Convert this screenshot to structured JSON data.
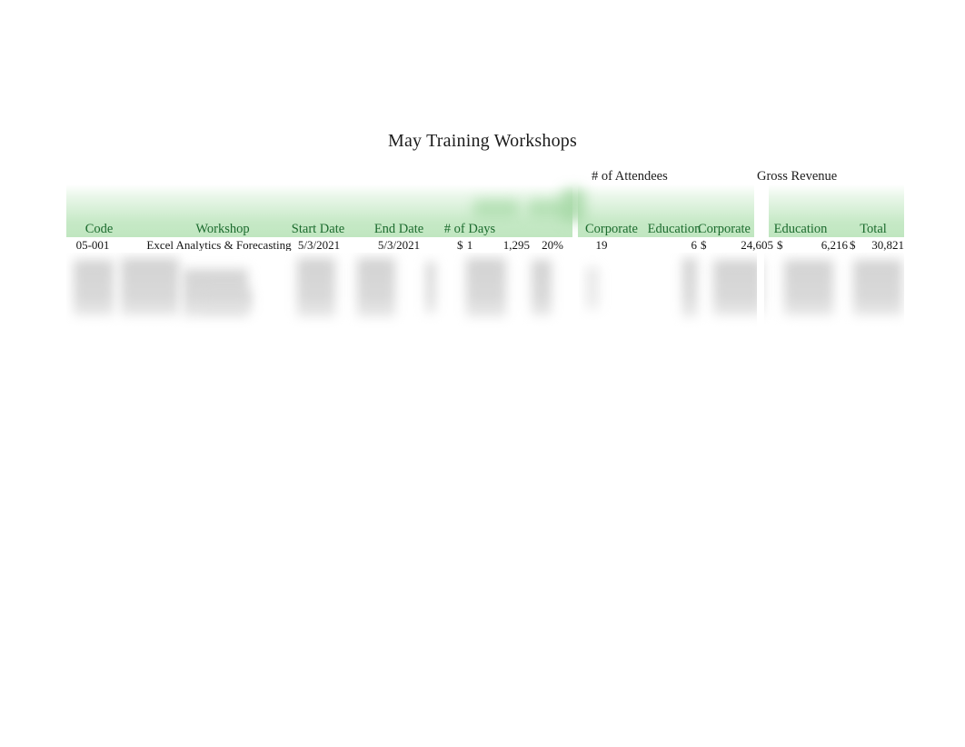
{
  "report": {
    "title": "May Training Workshops"
  },
  "theme": {
    "header_band_green": "#c6e9c6",
    "header_text_green": "#1c6b2e",
    "body_text": "#141414",
    "page_background": "#ffffff"
  },
  "table": {
    "group_headers": [
      {
        "label": "# of Attendees",
        "spans": [
          "Corporate",
          "Education"
        ]
      },
      {
        "label": "Gross Revenue",
        "spans": [
          "Corporate",
          "Education",
          "Total"
        ]
      }
    ],
    "columns": [
      {
        "key": "code",
        "label": "Code",
        "align": "center"
      },
      {
        "key": "workshop",
        "label": "Workshop",
        "align": "center"
      },
      {
        "key": "start_date",
        "label": "Start Date",
        "align": "center"
      },
      {
        "key": "end_date",
        "label": "End Date",
        "align": "center"
      },
      {
        "key": "days",
        "label": "# of Days",
        "align": "center"
      },
      {
        "key": "price",
        "label": "",
        "align": "center"
      },
      {
        "key": "discount",
        "label": "",
        "align": "center"
      },
      {
        "key": "att_corporate",
        "label": "Corporate",
        "align": "center"
      },
      {
        "key": "att_education",
        "label": "Education",
        "align": "center"
      },
      {
        "key": "rev_corporate",
        "label": "Corporate",
        "align": "center"
      },
      {
        "key": "rev_education",
        "label": "Education",
        "align": "center"
      },
      {
        "key": "rev_total",
        "label": "Total",
        "align": "center"
      }
    ],
    "rows": [
      {
        "code": "05-001",
        "workshop": "Excel Analytics & Forecasting",
        "start_date": "5/3/2021",
        "end_date": "5/3/2021",
        "days": "1",
        "price_symbol": "$",
        "price": "1,295",
        "discount": "20%",
        "att_corporate": "19",
        "att_education": "6",
        "rev_corporate_symbol": "$",
        "rev_corporate": "24,605",
        "rev_education_symbol": "$",
        "rev_education": "6,216",
        "rev_total_symbol": "$",
        "rev_total": "30,821"
      }
    ]
  }
}
